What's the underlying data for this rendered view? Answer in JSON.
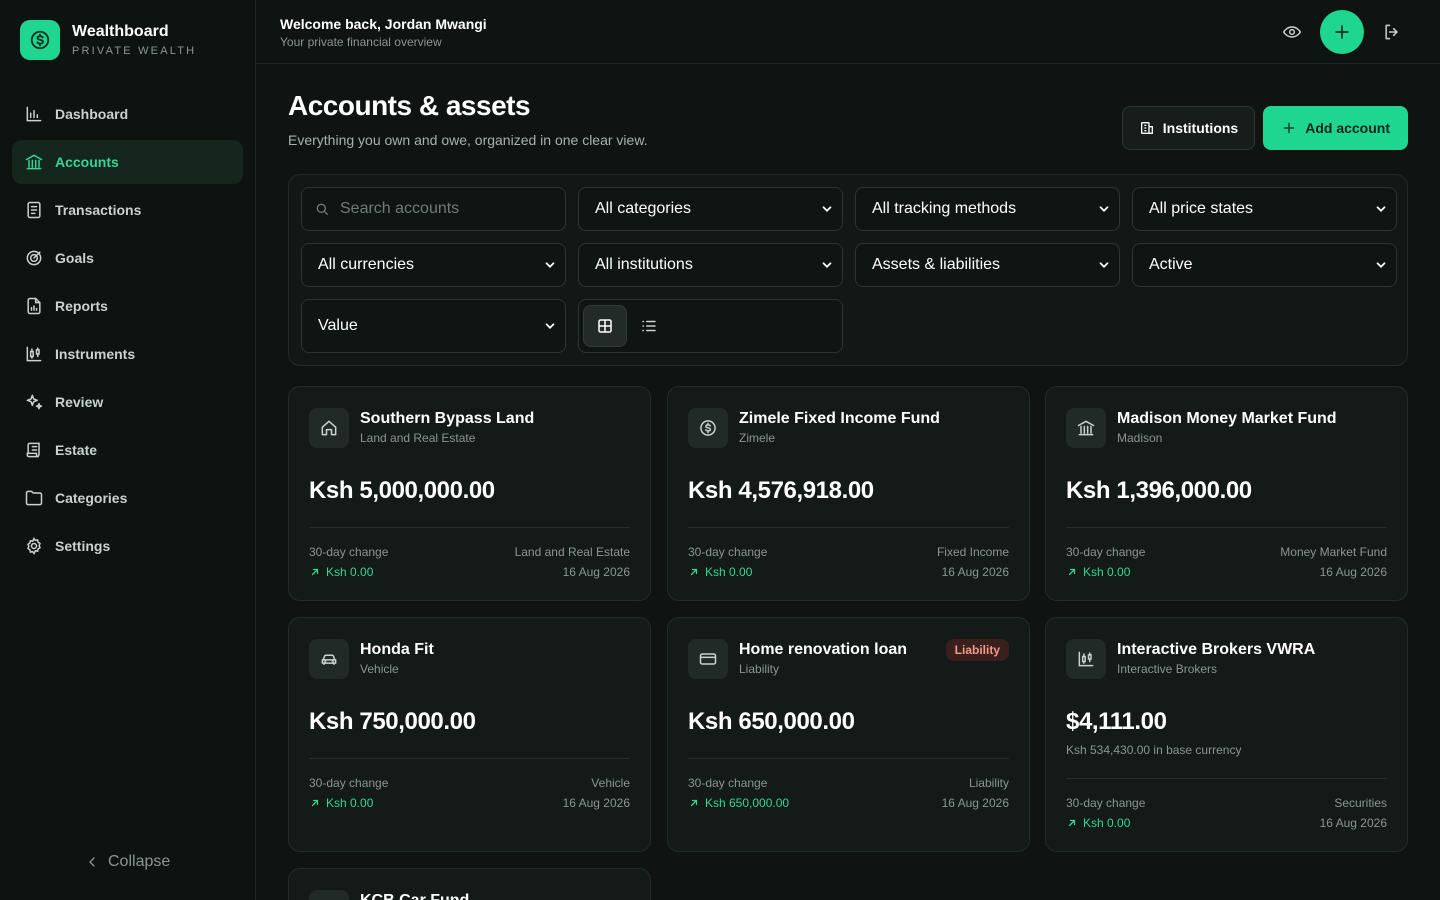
{
  "brand": {
    "name": "Wealthboard",
    "subtitle": "PRIVATE WEALTH"
  },
  "sidebar": {
    "items": [
      {
        "label": "Dashboard",
        "icon": "bar-chart-icon"
      },
      {
        "label": "Accounts",
        "icon": "bank-icon",
        "active": true
      },
      {
        "label": "Transactions",
        "icon": "receipt-icon"
      },
      {
        "label": "Goals",
        "icon": "target-icon"
      },
      {
        "label": "Reports",
        "icon": "report-icon"
      },
      {
        "label": "Instruments",
        "icon": "candlestick-icon"
      },
      {
        "label": "Review",
        "icon": "sparkles-icon"
      },
      {
        "label": "Estate",
        "icon": "scroll-icon"
      },
      {
        "label": "Categories",
        "icon": "folder-icon"
      },
      {
        "label": "Settings",
        "icon": "gear-icon"
      }
    ],
    "collapse_label": "Collapse"
  },
  "header": {
    "welcome": "Welcome back, Jordan Mwangi",
    "subtitle": "Your private financial overview"
  },
  "page": {
    "title": "Accounts & assets",
    "subtitle": "Everything you own and owe, organized in one clear view.",
    "institutions_label": "Institutions",
    "add_account_label": "Add account"
  },
  "filters": {
    "search_placeholder": "Search accounts",
    "category": "All categories",
    "tracking": "All tracking methods",
    "price_state": "All price states",
    "currency": "All currencies",
    "institution": "All institutions",
    "type": "Assets & liabilities",
    "status": "Active",
    "sort": "Value"
  },
  "cards": [
    {
      "title": "Southern Bypass Land",
      "subtitle": "Land and Real Estate",
      "icon": "home-icon",
      "value": "Ksh 5,000,000.00",
      "change_label": "30-day change",
      "change": "Ksh 0.00",
      "category": "Land and Real Estate",
      "date": "16 Aug 2026"
    },
    {
      "title": "Zimele Fixed Income Fund",
      "subtitle": "Zimele",
      "icon": "dollar-circle-icon",
      "value": "Ksh 4,576,918.00",
      "change_label": "30-day change",
      "change": "Ksh 0.00",
      "category": "Fixed Income",
      "date": "16 Aug 2026"
    },
    {
      "title": "Madison Money Market Fund",
      "subtitle": "Madison",
      "icon": "bank-icon",
      "value": "Ksh 1,396,000.00",
      "change_label": "30-day change",
      "change": "Ksh 0.00",
      "category": "Money Market Fund",
      "date": "16 Aug 2026"
    },
    {
      "title": "Honda Fit",
      "subtitle": "Vehicle",
      "icon": "car-icon",
      "value": "Ksh 750,000.00",
      "change_label": "30-day change",
      "change": "Ksh 0.00",
      "category": "Vehicle",
      "date": "16 Aug 2026"
    },
    {
      "title": "Home renovation loan",
      "subtitle": "Liability",
      "icon": "credit-card-icon",
      "badge": "Liability",
      "value": "Ksh 650,000.00",
      "change_label": "30-day change",
      "change": "Ksh 650,000.00",
      "category": "Liability",
      "date": "16 Aug 2026"
    },
    {
      "title": "Interactive Brokers VWRA",
      "subtitle": "Interactive Brokers",
      "icon": "candlestick-icon",
      "value": "$4,111.00",
      "base_value": "Ksh 534,430.00 in base currency",
      "change_label": "30-day change",
      "change": "Ksh 0.00",
      "category": "Securities",
      "date": "16 Aug 2026"
    },
    {
      "title": "KCB Car Fund",
      "icon": "wallet-icon"
    }
  ],
  "colors": {
    "accent": "#1ed68f",
    "background": "#0f1412",
    "liability_badge": "#f19a8f"
  }
}
